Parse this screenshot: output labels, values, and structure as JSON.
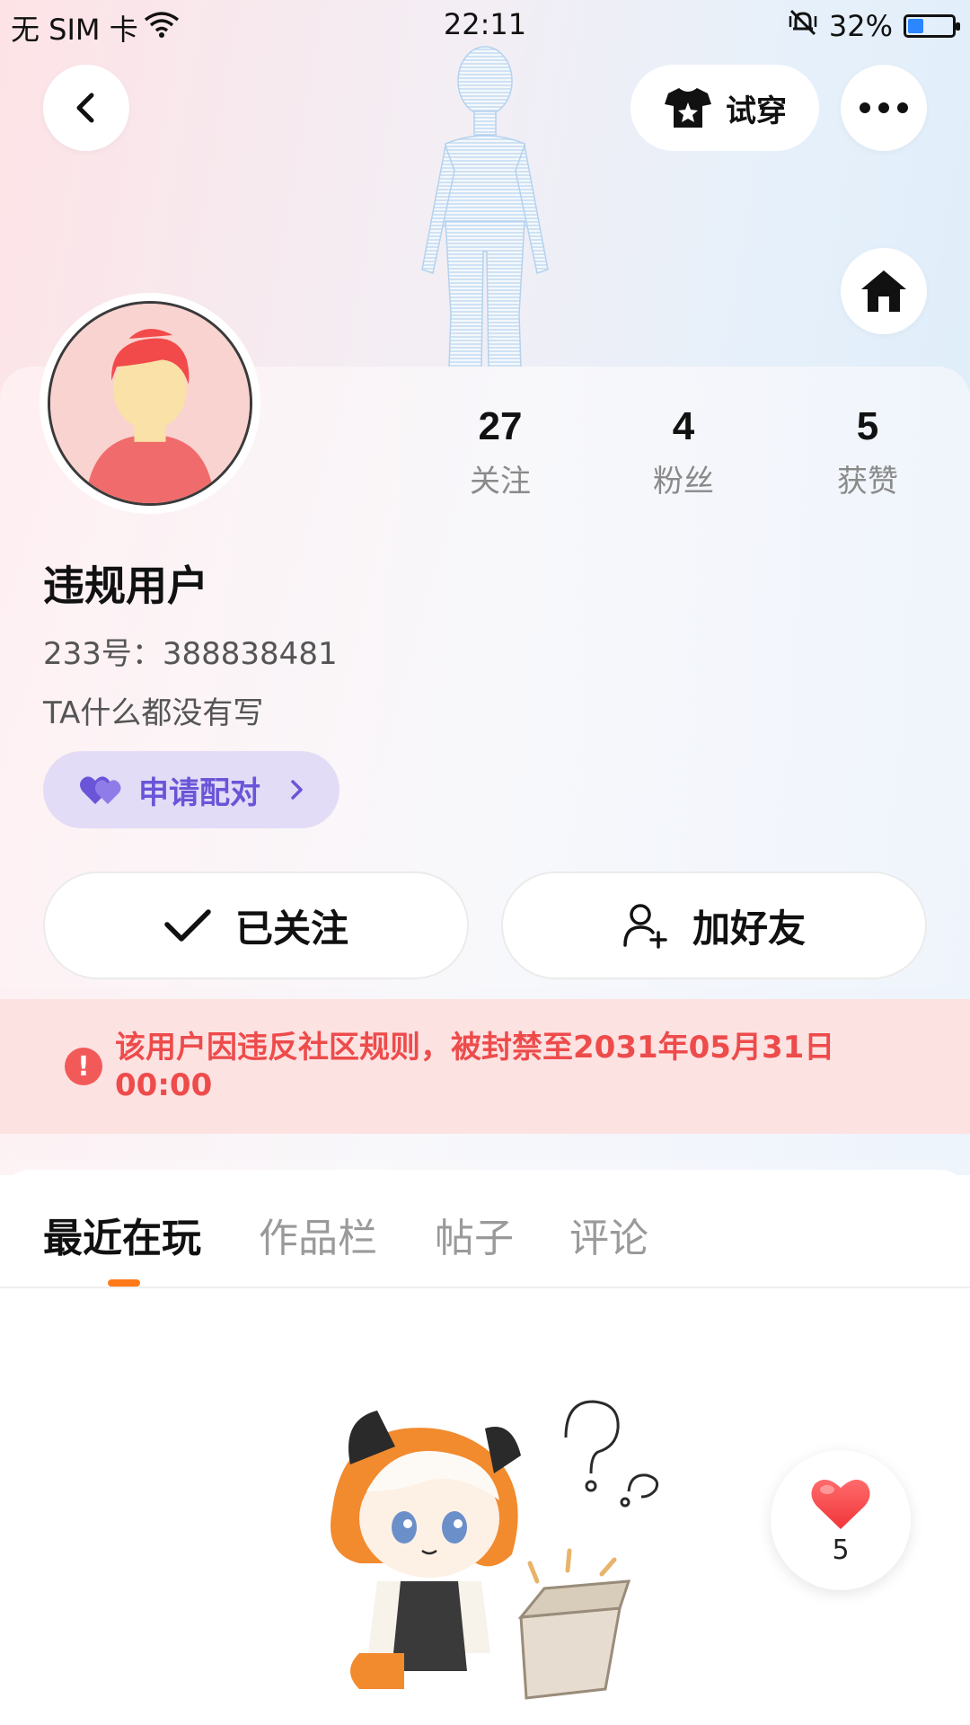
{
  "status_bar": {
    "carrier": "无 SIM 卡",
    "time": "22:11",
    "battery": "32%",
    "battery_level": 0.32
  },
  "header": {
    "try_on_label": "试穿"
  },
  "profile": {
    "following_count": "27",
    "following_label": "关注",
    "followers_count": "4",
    "followers_label": "粉丝",
    "likes_count": "5",
    "likes_label": "获赞",
    "name": "违规用户",
    "id_text": "233号：388838481",
    "bio": "TA什么都没有写",
    "pair_label": "申请配对"
  },
  "actions": {
    "followed_label": "已关注",
    "add_friend_label": "加好友"
  },
  "ban_notice": "该用户因违反社区规则，被封禁至2031年05月31日 00:00",
  "tabs": [
    {
      "label": "最近在玩",
      "active": true
    },
    {
      "label": "作品栏",
      "active": false
    },
    {
      "label": "帖子",
      "active": false
    },
    {
      "label": "评论",
      "active": false
    }
  ],
  "like_bubble": {
    "count": "5"
  },
  "colors": {
    "accent_orange": "#ff7a1a",
    "ban_red": "#ee4b4b",
    "pair_purple": "#6a55d8",
    "battery_blue": "#2b86ff"
  },
  "icons": [
    "back-icon",
    "tshirt-icon",
    "more-icon",
    "home-icon",
    "heart-icon",
    "check-icon",
    "add-user-icon",
    "alert-icon",
    "chevron-right-icon",
    "wifi-icon",
    "mute-icon"
  ]
}
